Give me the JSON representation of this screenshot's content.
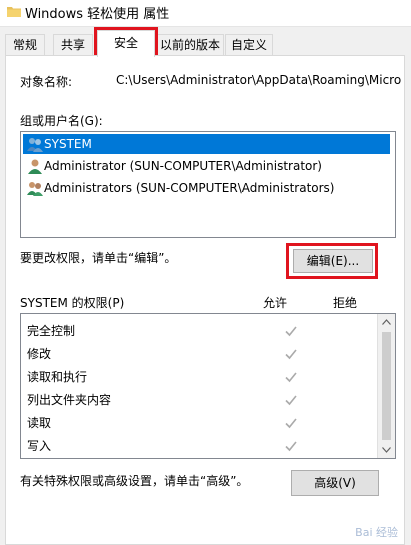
{
  "window": {
    "title": "Windows 轻松使用 属性",
    "icon": "folder-icon"
  },
  "tabs": [
    {
      "label": "常规",
      "active": false
    },
    {
      "label": "共享",
      "active": false
    },
    {
      "label": "安全",
      "active": true
    },
    {
      "label": "以前的版本",
      "active": false
    },
    {
      "label": "自定义",
      "active": false
    }
  ],
  "security": {
    "object_name_label": "对象名称:",
    "object_name_value": "C:\\Users\\Administrator\\AppData\\Roaming\\Micro",
    "groups_label": "组或用户名(G):",
    "users": [
      {
        "label": "SYSTEM",
        "icon": "group-users-icon",
        "selected": true
      },
      {
        "label": "Administrator (SUN-COMPUTER\\Administrator)",
        "icon": "user-icon",
        "selected": false
      },
      {
        "label": "Administrators (SUN-COMPUTER\\Administrators)",
        "icon": "group-users-icon",
        "selected": false
      }
    ],
    "change_hint": "要更改权限，请单击“编辑”。",
    "edit_button": "编辑(E)...",
    "permissions_label": "SYSTEM 的权限(P)",
    "allow_header": "允许",
    "deny_header": "拒绝",
    "permissions": [
      {
        "name": "完全控制",
        "allow": true,
        "deny": false
      },
      {
        "name": "修改",
        "allow": true,
        "deny": false
      },
      {
        "name": "读取和执行",
        "allow": true,
        "deny": false
      },
      {
        "name": "列出文件夹内容",
        "allow": true,
        "deny": false
      },
      {
        "name": "读取",
        "allow": true,
        "deny": false
      },
      {
        "name": "写入",
        "allow": true,
        "deny": false
      }
    ],
    "advanced_hint": "有关特殊权限或高级设置，请单击“高级”。",
    "advanced_button": "高级(V)"
  },
  "watermark": "Bai 经验",
  "colors": {
    "selection": "#0078d7",
    "highlight_box": "#e0141e",
    "check": "#aaaaaa"
  }
}
